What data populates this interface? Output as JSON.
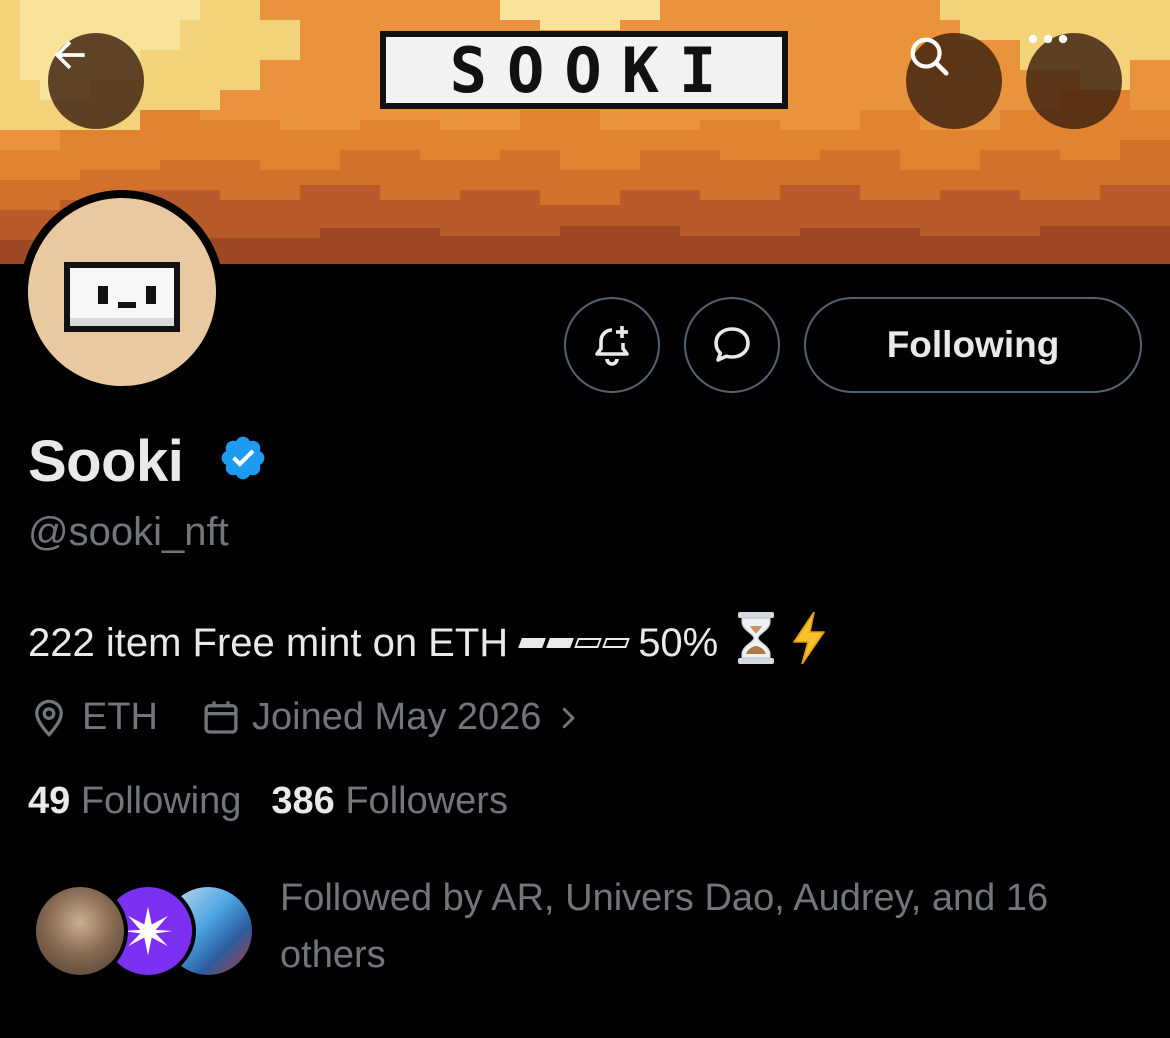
{
  "header": {
    "banner_logo_text": "SOOKI",
    "back_icon": "arrow-left-icon",
    "search_icon": "search-icon",
    "more_icon": "more-horizontal-icon"
  },
  "profile": {
    "display_name": "Sooki",
    "verified": true,
    "verified_color": "#1d9bf0",
    "handle": "@sooki_nft",
    "bio_text": "222 item Free mint on ETH",
    "bio_progress": {
      "filled_blocks": 2,
      "total_blocks": 4,
      "percent_label": "50%"
    },
    "bio_emojis": [
      "hourglass-emoji",
      "lightning-emoji"
    ],
    "location": "ETH",
    "joined": "Joined May 2026"
  },
  "actions": {
    "notify_icon": "bell-plus-icon",
    "message_icon": "message-bubble-icon",
    "follow_label": "Following"
  },
  "stats": {
    "following_count": "49",
    "following_label": "Following",
    "followers_count": "386",
    "followers_label": "Followers"
  },
  "followed_by": {
    "text": "Followed by AR, Univers Dao, Audrey, and 16 others",
    "avatars": [
      "follower-avatar-ar",
      "follower-avatar-univers-dao",
      "follower-avatar-audrey"
    ]
  },
  "colors": {
    "background": "#000000",
    "primary_text": "#e7e9ea",
    "secondary_text": "#71767b",
    "border": "#536471",
    "banner_orange": "#e9913a"
  }
}
